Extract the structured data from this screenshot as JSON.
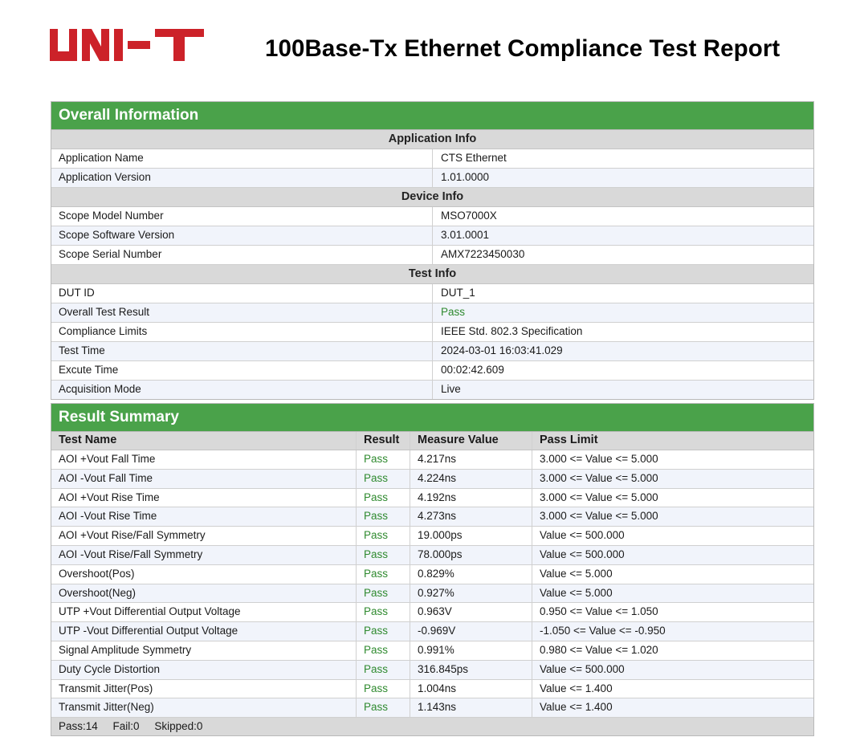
{
  "header": {
    "logo_text": "UNI-T",
    "title": "100Base-Tx Ethernet Compliance Test Report"
  },
  "colors": {
    "brand_red": "#cc2229",
    "header_green": "#4aa24a",
    "pass_green": "#2f8a2f"
  },
  "overall": {
    "title": "Overall Information",
    "sections": [
      {
        "title": "Application Info",
        "rows": [
          {
            "label": "Application Name",
            "value": "CTS Ethernet"
          },
          {
            "label": "Application Version",
            "value": "1.01.0000"
          }
        ]
      },
      {
        "title": "Device Info",
        "rows": [
          {
            "label": "Scope Model Number",
            "value": "MSO7000X"
          },
          {
            "label": "Scope Software Version",
            "value": "3.01.0001"
          },
          {
            "label": "Scope Serial Number",
            "value": "AMX7223450030"
          }
        ]
      },
      {
        "title": "Test Info",
        "rows": [
          {
            "label": "DUT ID",
            "value": "DUT_1"
          },
          {
            "label": "Overall Test Result",
            "value": "Pass"
          },
          {
            "label": "Compliance Limits",
            "value": "IEEE Std. 802.3 Specification"
          },
          {
            "label": "Test Time",
            "value": "2024-03-01 16:03:41.029"
          },
          {
            "label": "Excute Time",
            "value": "00:02:42.609"
          },
          {
            "label": "Acquisition Mode",
            "value": "Live"
          }
        ]
      }
    ]
  },
  "summary": {
    "title": "Result Summary",
    "columns": [
      "Test Name",
      "Result",
      "Measure Value",
      "Pass Limit"
    ],
    "rows": [
      {
        "name": "AOI +Vout Fall Time",
        "result": "Pass",
        "value": "4.217ns",
        "limit": "3.000 <= Value <= 5.000"
      },
      {
        "name": "AOI -Vout Fall Time",
        "result": "Pass",
        "value": "4.224ns",
        "limit": "3.000 <= Value <= 5.000"
      },
      {
        "name": "AOI +Vout Rise Time",
        "result": "Pass",
        "value": "4.192ns",
        "limit": "3.000 <= Value <= 5.000"
      },
      {
        "name": "AOI -Vout Rise Time",
        "result": "Pass",
        "value": "4.273ns",
        "limit": "3.000 <= Value <= 5.000"
      },
      {
        "name": "AOI +Vout Rise/Fall Symmetry",
        "result": "Pass",
        "value": "19.000ps",
        "limit": "Value <= 500.000"
      },
      {
        "name": "AOI -Vout Rise/Fall Symmetry",
        "result": "Pass",
        "value": "78.000ps",
        "limit": "Value <= 500.000"
      },
      {
        "name": "Overshoot(Pos)",
        "result": "Pass",
        "value": "0.829%",
        "limit": "Value <= 5.000"
      },
      {
        "name": "Overshoot(Neg)",
        "result": "Pass",
        "value": "0.927%",
        "limit": "Value <= 5.000"
      },
      {
        "name": "UTP +Vout Differential Output Voltage",
        "result": "Pass",
        "value": "0.963V",
        "limit": "0.950 <= Value <= 1.050"
      },
      {
        "name": "UTP -Vout Differential Output Voltage",
        "result": "Pass",
        "value": "-0.969V",
        "limit": "-1.050 <= Value <= -0.950"
      },
      {
        "name": "Signal Amplitude Symmetry",
        "result": "Pass",
        "value": "0.991%",
        "limit": "0.980 <= Value <= 1.020"
      },
      {
        "name": "Duty Cycle Distortion",
        "result": "Pass",
        "value": "316.845ps",
        "limit": "Value <= 500.000"
      },
      {
        "name": "Transmit Jitter(Pos)",
        "result": "Pass",
        "value": "1.004ns",
        "limit": "Value <= 1.400"
      },
      {
        "name": "Transmit Jitter(Neg)",
        "result": "Pass",
        "value": "1.143ns",
        "limit": "Value <= 1.400"
      }
    ],
    "footer": {
      "pass": "Pass:14",
      "fail": "Fail:0",
      "skipped": "Skipped:0"
    }
  }
}
